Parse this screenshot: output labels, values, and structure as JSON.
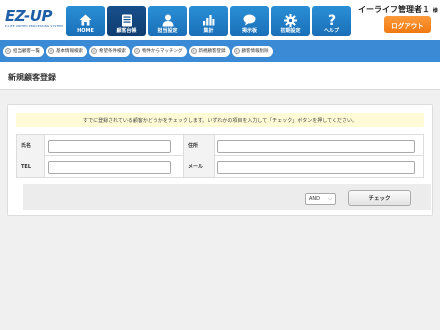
{
  "brand": {
    "logo": "EZ-UP",
    "logo_sub": "E-LIFE UNITED PROCESSING SYSTEM"
  },
  "nav": [
    {
      "label": "HOME",
      "icon": "home-icon"
    },
    {
      "label": "顧客台帳",
      "icon": "ledger-icon"
    },
    {
      "label": "担当設定",
      "icon": "person-icon"
    },
    {
      "label": "集計",
      "icon": "bar-chart-icon"
    },
    {
      "label": "掲示板",
      "icon": "speech-bubble-icon"
    },
    {
      "label": "初期設定",
      "icon": "gear-icon"
    },
    {
      "label": "ヘルプ",
      "icon": "question-icon"
    }
  ],
  "user": {
    "name": "イーライフ管理者１",
    "suffix": "様"
  },
  "logout_label": "ログアウト",
  "subnav": [
    "担当顧客一覧",
    "基本情報検索",
    "希望条件検索",
    "物件からマッチング",
    "新規顧客登録",
    "顧客情報削除"
  ],
  "page_title": "新規顧客登録",
  "notice": "すでに登録されている顧客かどうかをチェックします。いずれかの項目を入力して「チェック」ボタンを押してください。",
  "form": {
    "name_label": "氏名",
    "address_label": "住所",
    "tel_label": "TEL",
    "mail_label": "メール",
    "name_value": "",
    "address_value": "",
    "tel_value": "",
    "mail_value": ""
  },
  "condition_select": {
    "selected": "AND"
  },
  "check_button": "チェック",
  "colors": {
    "nav_blue": "#2a8fd6",
    "nav_active": "#174f8c",
    "subnav_bg": "#3a8ad6",
    "logout_orange": "#f07a10",
    "notice_bg": "#fffbd6"
  }
}
